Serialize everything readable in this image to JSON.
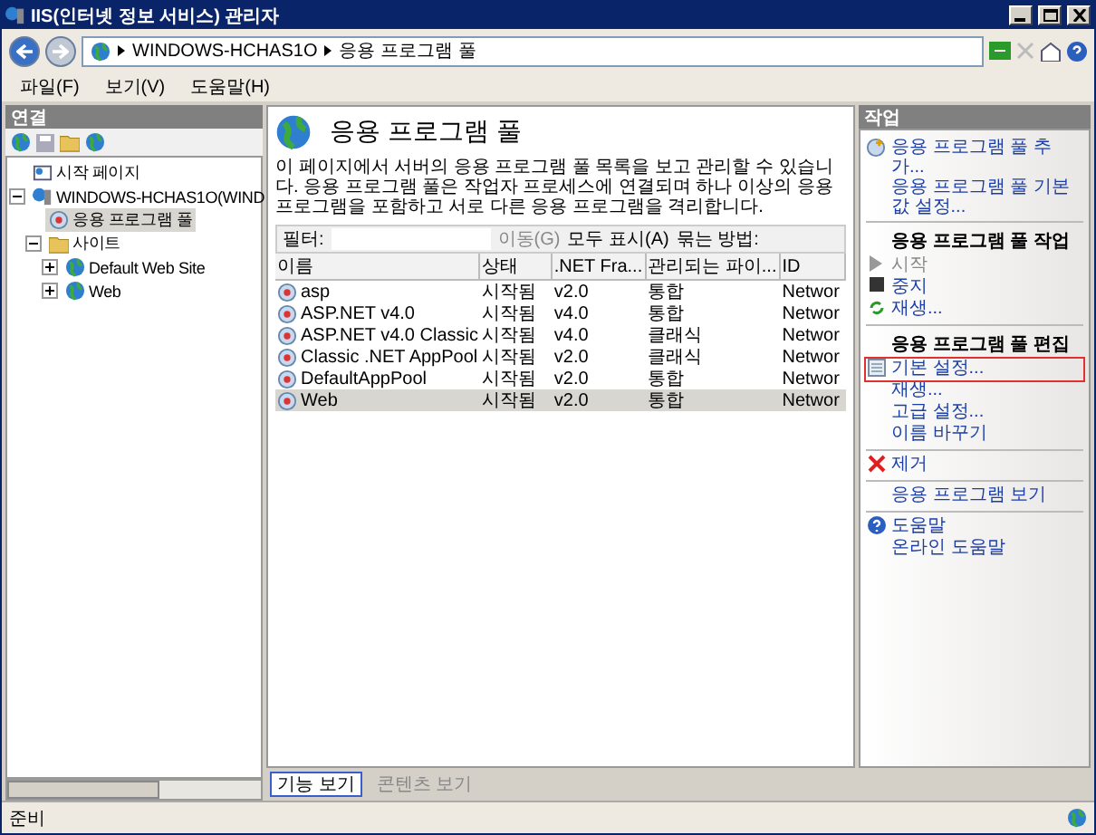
{
  "window": {
    "title": "IIS(인터넷 정보 서비스) 관리자"
  },
  "breadcrumb": [
    "WINDOWS-HCHAS1O",
    "응용 프로그램 풀"
  ],
  "menu": [
    "파일(F)",
    "보기(V)",
    "도움말(H)"
  ],
  "connections": {
    "title": "연결",
    "tree": [
      {
        "label": "시작 페이지",
        "kind": "start",
        "selected": false
      },
      {
        "label": "WINDOWS-HCHAS1O(WIND",
        "kind": "server",
        "selected": false,
        "expanded": true,
        "children": [
          {
            "label": "응용 프로그램 풀",
            "kind": "pool",
            "selected": true
          },
          {
            "label": "사이트",
            "kind": "folder",
            "selected": false,
            "expanded": true,
            "children": [
              {
                "label": "Default Web Site",
                "kind": "site",
                "selected": false,
                "expanded": false
              },
              {
                "label": "Web",
                "kind": "site",
                "selected": false,
                "expanded": false
              }
            ]
          }
        ]
      }
    ]
  },
  "page": {
    "title": "응용 프로그램 풀",
    "description": "이 페이지에서 서버의 응용 프로그램 풀 목록을 보고 관리할 수 있습니다. 응용 프로그램 풀은 작업자 프로세스에 연결되며 하나 이상의 응용 프로그램을 포함하고 서로 다른 응용 프로그램을 격리합니다.",
    "filter_label": "필터:",
    "go": "이동(G)",
    "show_all": "모두 표시(A)",
    "group_by": "묶는 방법:",
    "columns": [
      "이름",
      "상태",
      ".NET Fra...",
      "관리되는 파이...",
      "ID"
    ],
    "rows": [
      {
        "cells": [
          "asp",
          "시작됨",
          "v2.0",
          "통합",
          "Networ"
        ],
        "selected": false
      },
      {
        "cells": [
          "ASP.NET v4.0",
          "시작됨",
          "v4.0",
          "통합",
          "Networ"
        ],
        "selected": false
      },
      {
        "cells": [
          "ASP.NET v4.0 Classic",
          "시작됨",
          "v4.0",
          "클래식",
          "Networ"
        ],
        "selected": false
      },
      {
        "cells": [
          "Classic .NET AppPool",
          "시작됨",
          "v2.0",
          "클래식",
          "Networ"
        ],
        "selected": false
      },
      {
        "cells": [
          "DefaultAppPool",
          "시작됨",
          "v2.0",
          "통합",
          "Networ"
        ],
        "selected": false
      },
      {
        "cells": [
          "Web",
          "시작됨",
          "v2.0",
          "통합",
          "Networ"
        ],
        "selected": true
      }
    ],
    "views": [
      {
        "label": "기능 보기",
        "selected": true
      },
      {
        "label": "콘텐츠 보기",
        "selected": false
      }
    ]
  },
  "actions": {
    "title": "작업",
    "groups": [
      {
        "items": [
          {
            "label": "응용 프로그램 풀 추가...",
            "kind": "add",
            "disabled": false,
            "highlighted": false
          },
          {
            "label": "응용 프로그램 풀 기본값 설정...",
            "kind": "plain",
            "disabled": false,
            "highlighted": false
          }
        ]
      },
      {
        "header": "응용 프로그램 풀 작업",
        "items": [
          {
            "label": "시작",
            "kind": "start",
            "disabled": true,
            "highlighted": false
          },
          {
            "label": "중지",
            "kind": "stop",
            "disabled": false,
            "highlighted": false
          },
          {
            "label": "재생...",
            "kind": "recycle",
            "disabled": false,
            "highlighted": false
          }
        ]
      },
      {
        "header": "응용 프로그램 풀 편집",
        "items": [
          {
            "label": "기본 설정...",
            "kind": "settings",
            "disabled": false,
            "highlighted": true
          },
          {
            "label": "재생...",
            "kind": "plain",
            "disabled": false,
            "highlighted": false
          },
          {
            "label": "고급 설정...",
            "kind": "plain",
            "disabled": false,
            "highlighted": false
          },
          {
            "label": "이름 바꾸기",
            "kind": "plain",
            "disabled": false,
            "highlighted": false
          }
        ]
      },
      {
        "items": [
          {
            "label": "제거",
            "kind": "remove",
            "disabled": false,
            "highlighted": false
          }
        ]
      },
      {
        "items": [
          {
            "label": "응용 프로그램 보기",
            "kind": "plain",
            "disabled": false,
            "highlighted": false
          }
        ]
      },
      {
        "items": [
          {
            "label": "도움말",
            "kind": "help",
            "disabled": false,
            "highlighted": false
          },
          {
            "label": "온라인 도움말",
            "kind": "plain",
            "disabled": false,
            "highlighted": false
          }
        ]
      }
    ]
  },
  "status": "준비"
}
